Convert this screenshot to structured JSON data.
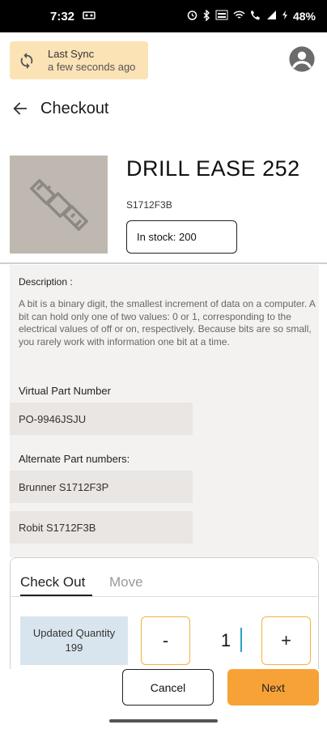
{
  "status_bar": {
    "time": "7:32",
    "battery": "48%"
  },
  "sync": {
    "title": "Last Sync",
    "subtitle": "a few seconds ago"
  },
  "header": {
    "title": "Checkout"
  },
  "product": {
    "name": "DRILL EASE 252",
    "sku": "S1712F3B",
    "stock": "In stock: 200"
  },
  "details": {
    "description_label": "Description :",
    "description": "A bit is a binary digit, the smallest increment of data on a computer. A bit can hold only one of two values: 0 or 1, corresponding to the electrical values of off or on, respectively. Because bits are so small, you rarely work with information one bit at a time.",
    "virtual_part_label": "Virtual Part Number",
    "virtual_part_value": "PO-9946JSJU",
    "alternate_label": "Alternate Part numbers:",
    "alternates": [
      "Brunner  S1712F3P",
      "Robit  S1712F3B"
    ]
  },
  "checkout": {
    "tabs": [
      "Check Out",
      "Move"
    ],
    "updated_quantity_label": "Updated Quantity",
    "updated_quantity_value": "199",
    "minus_label": "-",
    "plus_label": "+",
    "quantity_value": "1"
  },
  "actions": {
    "cancel_label": "Cancel",
    "next_label": "Next"
  },
  "colors": {
    "sync_bg": "#fbe3b6",
    "accent": "#f7a237",
    "stepper_border": "#f2b33d",
    "qty_bg": "#d9e5ee"
  }
}
